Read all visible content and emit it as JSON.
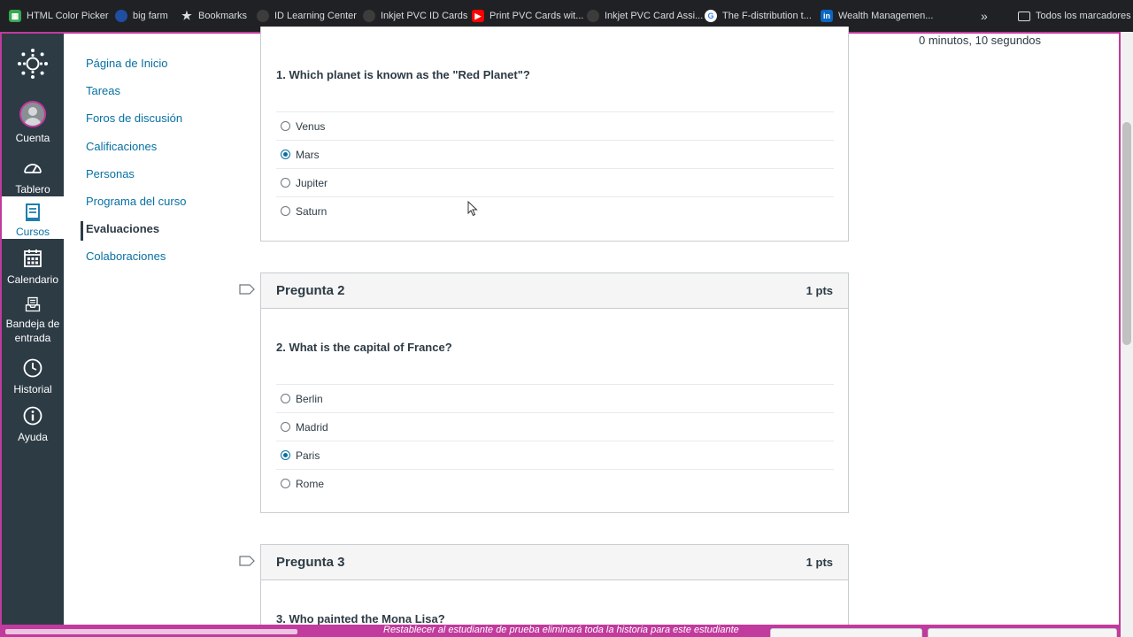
{
  "bookmarks": [
    {
      "label": "HTML Color Picker",
      "icon": "html-color-picker-icon",
      "color": "#36a852"
    },
    {
      "label": "big farm",
      "icon": "big-farm-icon",
      "color": "#1f4ea3"
    },
    {
      "label": "Bookmarks",
      "icon": "star-icon",
      "color": "#dadce0"
    },
    {
      "label": "ID Learning Center",
      "icon": "site-icon",
      "color": "#3c3c3c"
    },
    {
      "label": "Inkjet PVC ID Cards",
      "icon": "site-icon",
      "color": "#3c3c3c"
    },
    {
      "label": "Print PVC Cards wit...",
      "icon": "youtube-icon",
      "color": "#ff0000"
    },
    {
      "label": "Inkjet PVC Card Assi...",
      "icon": "site-icon",
      "color": "#3c3c3c"
    },
    {
      "label": "The F-distribution t...",
      "icon": "google-icon",
      "color": "#ffffff"
    },
    {
      "label": "Wealth Managemen...",
      "icon": "linkedin-icon",
      "color": "#0a66c2"
    }
  ],
  "all_bookmarks": "Todos los marcadores",
  "global_nav": {
    "account": "Cuenta",
    "dashboard": "Tablero",
    "courses": "Cursos",
    "calendar": "Calendario",
    "inbox": "Bandeja de entrada",
    "history": "Historial",
    "help": "Ayuda"
  },
  "course_nav": [
    "Página de Inicio",
    "Tareas",
    "Foros de discusión",
    "Calificaciones",
    "Personas",
    "Programa del curso",
    "Evaluaciones",
    "Colaboraciones"
  ],
  "timer": "0 minutos, 10 segundos",
  "questions": [
    {
      "text": "1. Which planet is known as the \"Red Planet\"?",
      "answers": [
        "Venus",
        "Mars",
        "Jupiter",
        "Saturn"
      ],
      "selected": 1
    },
    {
      "title": "Pregunta 2",
      "points": "1 pts",
      "text": "2. What is the capital of France?",
      "answers": [
        "Berlin",
        "Madrid",
        "Paris",
        "Rome"
      ],
      "selected": 2
    },
    {
      "title": "Pregunta 3",
      "points": "1 pts",
      "text": "3. Who painted the Mona Lisa?"
    }
  ],
  "student_view_notice": "Restablecer al estudiante de prueba eliminará toda la historia para este estudiante",
  "colors": {
    "canvas_nav": "#2d3b45",
    "link": "#0770a3",
    "student_view": "#c13a9d"
  }
}
